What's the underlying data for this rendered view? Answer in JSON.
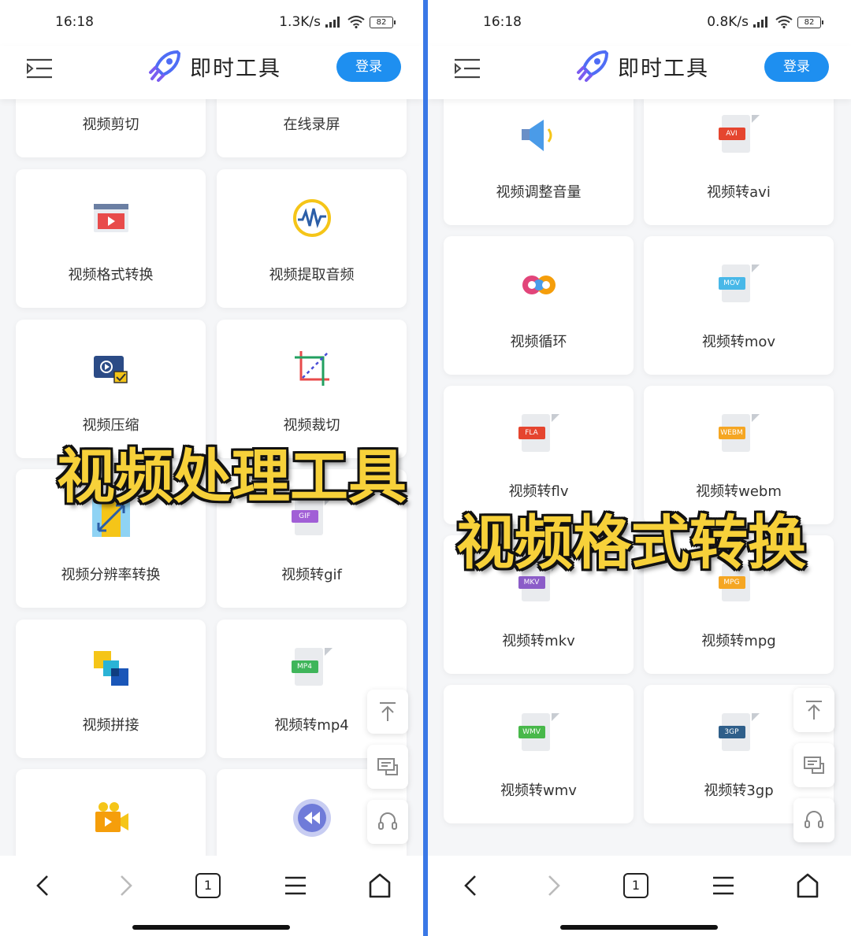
{
  "left": {
    "status": {
      "time": "16:18",
      "speed": "1.3K/s",
      "battery": "82"
    },
    "header": {
      "brand": "即时工具",
      "login": "登录"
    },
    "cards": [
      {
        "label": "视频剪切",
        "icon": "",
        "color": ""
      },
      {
        "label": "在线录屏",
        "icon": "",
        "color": ""
      },
      {
        "label": "视频格式转换",
        "icon": "video-player-icon",
        "color": "#e84b4b"
      },
      {
        "label": "视频提取音频",
        "icon": "audio-wave-icon",
        "color": "#f5c518"
      },
      {
        "label": "视频压缩",
        "icon": "video-compress-icon",
        "color": "#2b6cb0"
      },
      {
        "label": "视频裁切",
        "icon": "crop-icon",
        "color": "#22a060"
      },
      {
        "label": "视频分辨率转换",
        "icon": "resize-arrow-icon",
        "color": "#52b6f0"
      },
      {
        "label": "视频转gif",
        "icon": "file-gif-icon",
        "tag": "GIF",
        "color": "#a15fd6"
      },
      {
        "label": "视频拼接",
        "icon": "blocks-icon",
        "color": "#1a56b8"
      },
      {
        "label": "视频转mp4",
        "icon": "file-mp4-icon",
        "tag": "MP4",
        "color": "#3fb55a"
      },
      {
        "label": "",
        "icon": "video-camera-icon",
        "color": "#f59e0b"
      },
      {
        "label": "",
        "icon": "rewind-icon",
        "color": "#6f7bd9"
      }
    ],
    "overlay": "视频处理工具"
  },
  "right": {
    "status": {
      "time": "16:18",
      "speed": "0.8K/s",
      "battery": "82"
    },
    "header": {
      "brand": "即时工具",
      "login": "登录"
    },
    "cards": [
      {
        "label": "视频调整音量",
        "icon": "speaker-icon",
        "color": "#4a9be8"
      },
      {
        "label": "视频转avi",
        "icon": "file-avi-icon",
        "tag": "AVI",
        "color": "#e5452f"
      },
      {
        "label": "视频循环",
        "icon": "loop-icon",
        "color": "#e2457a"
      },
      {
        "label": "视频转mov",
        "icon": "file-mov-icon",
        "tag": "MOV",
        "color": "#48b8e8"
      },
      {
        "label": "视频转flv",
        "icon": "file-fla-icon",
        "tag": "FLA",
        "color": "#e5452f"
      },
      {
        "label": "视频转webm",
        "icon": "file-webm-icon",
        "tag": "WEBM",
        "color": "#f5a623"
      },
      {
        "label": "视频转mkv",
        "icon": "file-mkv-icon",
        "tag": "MKV",
        "color": "#8b5cc8"
      },
      {
        "label": "视频转mpg",
        "icon": "file-mpg-icon",
        "tag": "MPG",
        "color": "#f5a623"
      },
      {
        "label": "视频转wmv",
        "icon": "file-wmv-icon",
        "tag": "WMV",
        "color": "#48b84a"
      },
      {
        "label": "视频转3gp",
        "icon": "file-3gp-icon",
        "tag": "3GP",
        "color": "#2f5f8a"
      }
    ],
    "overlay": "视频格式转换"
  },
  "nav": {
    "tabs_count": "1"
  }
}
